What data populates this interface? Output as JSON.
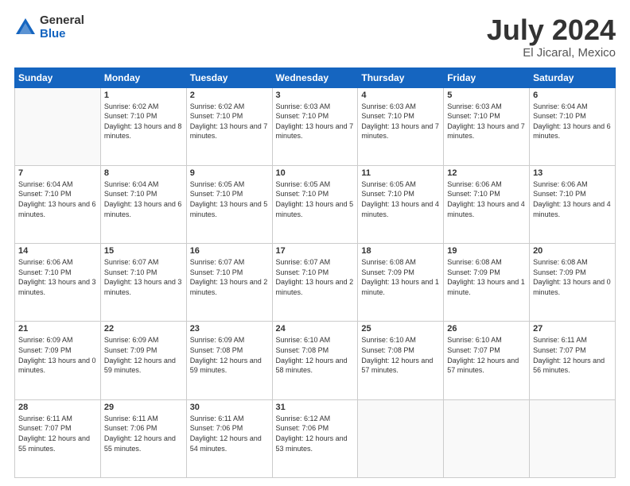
{
  "logo": {
    "general": "General",
    "blue": "Blue"
  },
  "title": {
    "month_year": "July 2024",
    "location": "El Jicaral, Mexico"
  },
  "weekdays": [
    "Sunday",
    "Monday",
    "Tuesday",
    "Wednesday",
    "Thursday",
    "Friday",
    "Saturday"
  ],
  "weeks": [
    [
      {
        "day": "",
        "sunrise": "",
        "sunset": "",
        "daylight": ""
      },
      {
        "day": "1",
        "sunrise": "Sunrise: 6:02 AM",
        "sunset": "Sunset: 7:10 PM",
        "daylight": "Daylight: 13 hours and 8 minutes."
      },
      {
        "day": "2",
        "sunrise": "Sunrise: 6:02 AM",
        "sunset": "Sunset: 7:10 PM",
        "daylight": "Daylight: 13 hours and 7 minutes."
      },
      {
        "day": "3",
        "sunrise": "Sunrise: 6:03 AM",
        "sunset": "Sunset: 7:10 PM",
        "daylight": "Daylight: 13 hours and 7 minutes."
      },
      {
        "day": "4",
        "sunrise": "Sunrise: 6:03 AM",
        "sunset": "Sunset: 7:10 PM",
        "daylight": "Daylight: 13 hours and 7 minutes."
      },
      {
        "day": "5",
        "sunrise": "Sunrise: 6:03 AM",
        "sunset": "Sunset: 7:10 PM",
        "daylight": "Daylight: 13 hours and 7 minutes."
      },
      {
        "day": "6",
        "sunrise": "Sunrise: 6:04 AM",
        "sunset": "Sunset: 7:10 PM",
        "daylight": "Daylight: 13 hours and 6 minutes."
      }
    ],
    [
      {
        "day": "7",
        "sunrise": "Sunrise: 6:04 AM",
        "sunset": "Sunset: 7:10 PM",
        "daylight": "Daylight: 13 hours and 6 minutes."
      },
      {
        "day": "8",
        "sunrise": "Sunrise: 6:04 AM",
        "sunset": "Sunset: 7:10 PM",
        "daylight": "Daylight: 13 hours and 6 minutes."
      },
      {
        "day": "9",
        "sunrise": "Sunrise: 6:05 AM",
        "sunset": "Sunset: 7:10 PM",
        "daylight": "Daylight: 13 hours and 5 minutes."
      },
      {
        "day": "10",
        "sunrise": "Sunrise: 6:05 AM",
        "sunset": "Sunset: 7:10 PM",
        "daylight": "Daylight: 13 hours and 5 minutes."
      },
      {
        "day": "11",
        "sunrise": "Sunrise: 6:05 AM",
        "sunset": "Sunset: 7:10 PM",
        "daylight": "Daylight: 13 hours and 4 minutes."
      },
      {
        "day": "12",
        "sunrise": "Sunrise: 6:06 AM",
        "sunset": "Sunset: 7:10 PM",
        "daylight": "Daylight: 13 hours and 4 minutes."
      },
      {
        "day": "13",
        "sunrise": "Sunrise: 6:06 AM",
        "sunset": "Sunset: 7:10 PM",
        "daylight": "Daylight: 13 hours and 4 minutes."
      }
    ],
    [
      {
        "day": "14",
        "sunrise": "Sunrise: 6:06 AM",
        "sunset": "Sunset: 7:10 PM",
        "daylight": "Daylight: 13 hours and 3 minutes."
      },
      {
        "day": "15",
        "sunrise": "Sunrise: 6:07 AM",
        "sunset": "Sunset: 7:10 PM",
        "daylight": "Daylight: 13 hours and 3 minutes."
      },
      {
        "day": "16",
        "sunrise": "Sunrise: 6:07 AM",
        "sunset": "Sunset: 7:10 PM",
        "daylight": "Daylight: 13 hours and 2 minutes."
      },
      {
        "day": "17",
        "sunrise": "Sunrise: 6:07 AM",
        "sunset": "Sunset: 7:10 PM",
        "daylight": "Daylight: 13 hours and 2 minutes."
      },
      {
        "day": "18",
        "sunrise": "Sunrise: 6:08 AM",
        "sunset": "Sunset: 7:09 PM",
        "daylight": "Daylight: 13 hours and 1 minute."
      },
      {
        "day": "19",
        "sunrise": "Sunrise: 6:08 AM",
        "sunset": "Sunset: 7:09 PM",
        "daylight": "Daylight: 13 hours and 1 minute."
      },
      {
        "day": "20",
        "sunrise": "Sunrise: 6:08 AM",
        "sunset": "Sunset: 7:09 PM",
        "daylight": "Daylight: 13 hours and 0 minutes."
      }
    ],
    [
      {
        "day": "21",
        "sunrise": "Sunrise: 6:09 AM",
        "sunset": "Sunset: 7:09 PM",
        "daylight": "Daylight: 13 hours and 0 minutes."
      },
      {
        "day": "22",
        "sunrise": "Sunrise: 6:09 AM",
        "sunset": "Sunset: 7:09 PM",
        "daylight": "Daylight: 12 hours and 59 minutes."
      },
      {
        "day": "23",
        "sunrise": "Sunrise: 6:09 AM",
        "sunset": "Sunset: 7:08 PM",
        "daylight": "Daylight: 12 hours and 59 minutes."
      },
      {
        "day": "24",
        "sunrise": "Sunrise: 6:10 AM",
        "sunset": "Sunset: 7:08 PM",
        "daylight": "Daylight: 12 hours and 58 minutes."
      },
      {
        "day": "25",
        "sunrise": "Sunrise: 6:10 AM",
        "sunset": "Sunset: 7:08 PM",
        "daylight": "Daylight: 12 hours and 57 minutes."
      },
      {
        "day": "26",
        "sunrise": "Sunrise: 6:10 AM",
        "sunset": "Sunset: 7:07 PM",
        "daylight": "Daylight: 12 hours and 57 minutes."
      },
      {
        "day": "27",
        "sunrise": "Sunrise: 6:11 AM",
        "sunset": "Sunset: 7:07 PM",
        "daylight": "Daylight: 12 hours and 56 minutes."
      }
    ],
    [
      {
        "day": "28",
        "sunrise": "Sunrise: 6:11 AM",
        "sunset": "Sunset: 7:07 PM",
        "daylight": "Daylight: 12 hours and 55 minutes."
      },
      {
        "day": "29",
        "sunrise": "Sunrise: 6:11 AM",
        "sunset": "Sunset: 7:06 PM",
        "daylight": "Daylight: 12 hours and 55 minutes."
      },
      {
        "day": "30",
        "sunrise": "Sunrise: 6:11 AM",
        "sunset": "Sunset: 7:06 PM",
        "daylight": "Daylight: 12 hours and 54 minutes."
      },
      {
        "day": "31",
        "sunrise": "Sunrise: 6:12 AM",
        "sunset": "Sunset: 7:06 PM",
        "daylight": "Daylight: 12 hours and 53 minutes."
      },
      {
        "day": "",
        "sunrise": "",
        "sunset": "",
        "daylight": ""
      },
      {
        "day": "",
        "sunrise": "",
        "sunset": "",
        "daylight": ""
      },
      {
        "day": "",
        "sunrise": "",
        "sunset": "",
        "daylight": ""
      }
    ]
  ]
}
